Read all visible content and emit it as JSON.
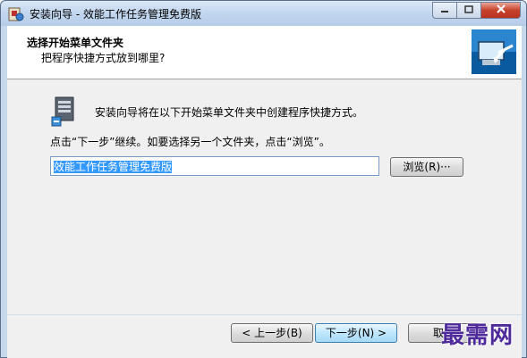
{
  "window": {
    "title": "安装向导 - 效能工作任务管理免费版",
    "controls": {
      "minimize_icon": "minimize-icon",
      "maximize_icon": "maximize-icon",
      "close_icon": "close-icon"
    }
  },
  "header": {
    "title": "选择开始菜单文件夹",
    "subtitle": "把程序快捷方式放到哪里?"
  },
  "body": {
    "intro": "安装向导将在以下开始菜单文件夹中创建程序快捷方式。",
    "instruction": "点击“下一步”继续。如要选择另一个文件夹，点击“浏览”。",
    "folder_value": "效能工作任务管理免费版",
    "browse_label": "浏览(R)···"
  },
  "footer": {
    "back_label": "< 上一步(B)",
    "next_label": "下一步(N) >",
    "cancel_label": "取消"
  },
  "watermark": "最需网",
  "colors": {
    "selection": "#3399ff",
    "watermark": "#4e2a9a",
    "accent": "#3c7fb1"
  }
}
